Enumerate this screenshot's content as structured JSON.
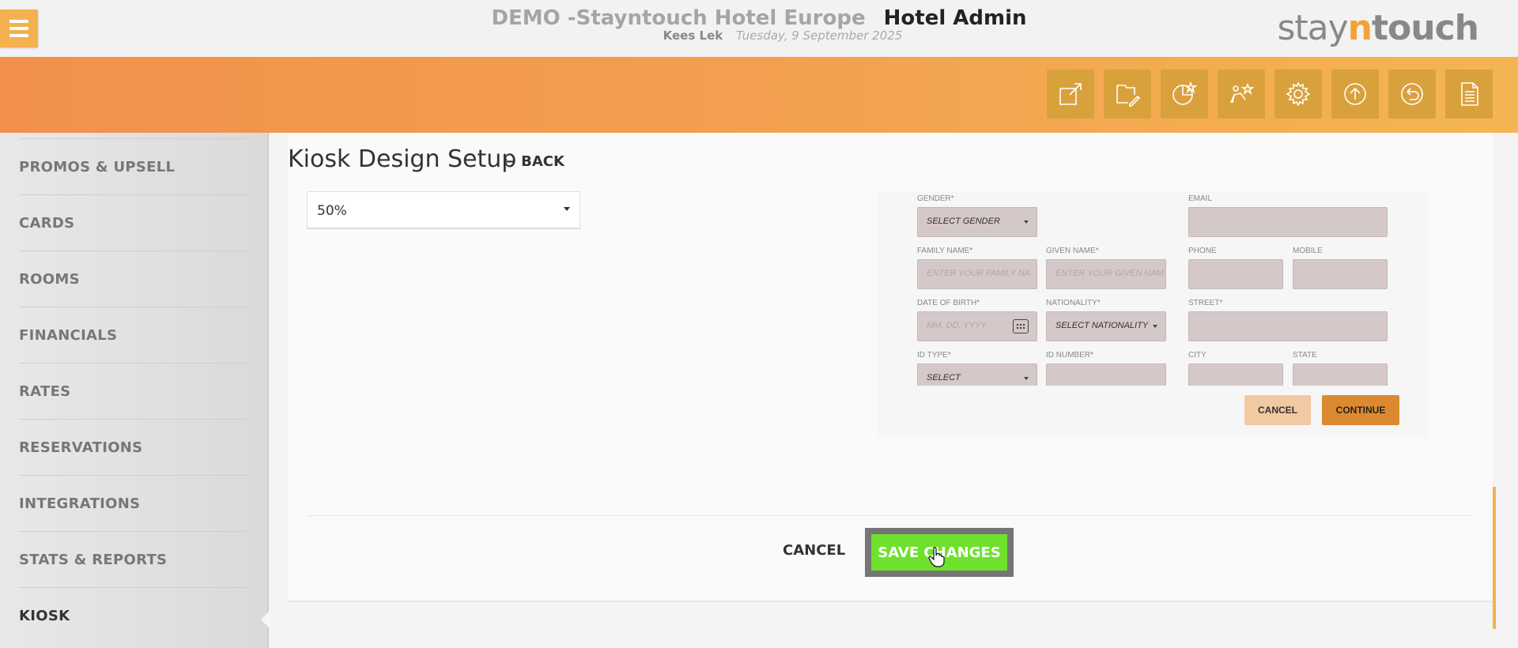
{
  "header": {
    "hotel_name": "DEMO -Stayntouch Hotel Europe",
    "app_name": "Hotel Admin",
    "user": "Kees Lek",
    "date": "Tuesday, 9 September 2025",
    "brand_a": "stay",
    "brand_b": "n",
    "brand_c": "touch"
  },
  "toolbar": {
    "icons": [
      "external-link-icon",
      "edit-doc-icon",
      "pie-chart-star-icon",
      "user-star-icon",
      "gear-icon",
      "upload-icon",
      "undo-icon",
      "document-icon"
    ]
  },
  "sidebar": {
    "items": [
      {
        "label": "PROMOS & UPSELL"
      },
      {
        "label": "CARDS"
      },
      {
        "label": "ROOMS"
      },
      {
        "label": "FINANCIALS"
      },
      {
        "label": "RATES"
      },
      {
        "label": "RESERVATIONS"
      },
      {
        "label": "INTEGRATIONS"
      },
      {
        "label": "STATS & REPORTS"
      },
      {
        "label": "KIOSK"
      }
    ],
    "active": "KIOSK"
  },
  "main": {
    "title": "Kiosk Design Setup",
    "back_label": "BACK",
    "select_value": "50%",
    "cancel_label": "CANCEL",
    "save_label": "SAVE CHANGES"
  },
  "preview": {
    "gender_label": "GENDER*",
    "gender_value": "SELECT GENDER",
    "email_label": "EMAIL",
    "family_label": "FAMILY NAME*",
    "family_placeholder": "ENTER YOUR FAMILY NA",
    "given_label": "GIVEN NAME*",
    "given_placeholder": "ENTER YOUR GIVEN NAM",
    "phone_label": "PHONE",
    "mobile_label": "MOBILE",
    "dob_label": "DATE OF BIRTH*",
    "dob_placeholder": "MM, DD, YYYY",
    "nationality_label": "NATIONALITY*",
    "nationality_value": "SELECT NATIONALITY",
    "street_label": "STREET*",
    "idtype_label": "ID TYPE*",
    "idtype_value": "SELECT",
    "idnumber_label": "ID NUMBER*",
    "city_label": "CITY",
    "state_label": "STATE",
    "cancel_label": "CANCEL",
    "continue_label": "CONTINUE"
  },
  "colors": {
    "accent": "#f3b14f",
    "save_green": "#6ee12d",
    "preview_field": "#d5c8c8",
    "preview_continue": "#dc8a31"
  }
}
